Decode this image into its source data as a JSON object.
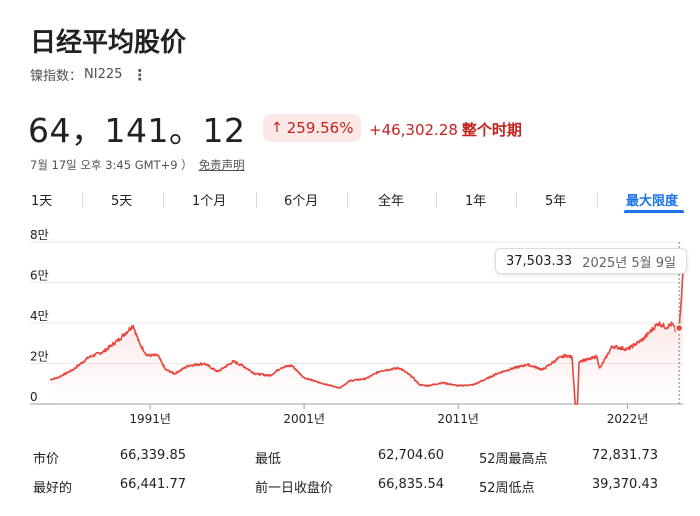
{
  "header": {
    "title": "日经平均股价",
    "index_label": "镍指数：",
    "ticker": "NI225",
    "more_icon": "more-vert-icon"
  },
  "quote": {
    "price": "64，141。12",
    "change_percent": "259.56%",
    "change_arrow": "↑",
    "change_abs": "+46,302.28",
    "period_label": "整个时期",
    "timestamp": "7월 17일 오후 3:45 GMT+9 ）",
    "disclaimer": "免责声明",
    "trend_color": "#c5221f"
  },
  "tabs": [
    {
      "label": "1天",
      "active": false
    },
    {
      "label": "5天",
      "active": false
    },
    {
      "label": "1个月",
      "active": false
    },
    {
      "label": "6个月",
      "active": false
    },
    {
      "label": "全年",
      "active": false
    },
    {
      "label": "1年",
      "active": false
    },
    {
      "label": "5年",
      "active": false
    },
    {
      "label": "最大限度",
      "active": true
    }
  ],
  "tooltip": {
    "value": "37,503.33",
    "date": "2025년 5월 9일"
  },
  "chart_data": {
    "type": "line",
    "y_tick_labels": [
      "8만",
      "6만",
      "4만",
      "2만",
      "0"
    ],
    "y_ticks": [
      80000,
      60000,
      40000,
      20000,
      0
    ],
    "ylim": [
      0,
      80000
    ],
    "x_tick_labels": [
      "1991년",
      "2001년",
      "2011년",
      "2022년"
    ],
    "x_ticks": [
      1991,
      2001,
      2011,
      2022
    ],
    "xlim": [
      1984.5,
      2025.6
    ],
    "line_color": "#e8453c",
    "series": [
      {
        "x": [
          1984.5,
          1985,
          1986,
          1987,
          1988,
          1989,
          1989.9,
          1990.3,
          1990.8,
          1991.5,
          1992,
          1992.6,
          1993.5,
          1994.5,
          1995.4,
          1996.4,
          1997,
          1997.8,
          1998.8,
          1999.5,
          2000.2,
          2001,
          2002,
          2003.3,
          2004,
          2005,
          2006,
          2007.2,
          2008,
          2008.5,
          2009,
          2010,
          2011,
          2012,
          2013,
          2013.5,
          2014.5,
          2015.5,
          2016.5,
          2017.5,
          2018,
          2018.4,
          2018.6,
          2018.75,
          2018.85,
          2019,
          2019.5,
          2020,
          2020.2,
          2021,
          2022,
          2023,
          2024,
          2024.5,
          2024.9,
          2025.1,
          2025.35,
          2025.5,
          2025.6
        ],
        "y": [
          12000,
          13000,
          17000,
          23000,
          26000,
          32000,
          38900,
          30000,
          24000,
          24000,
          17000,
          15000,
          19000,
          20000,
          16000,
          21000,
          19000,
          15000,
          14000,
          18000,
          19000,
          13000,
          10500,
          8000,
          11500,
          12500,
          16500,
          17800,
          13500,
          9500,
          9000,
          10500,
          9000,
          9500,
          13000,
          15000,
          17500,
          19500,
          17000,
          22500,
          24000,
          23000,
          0,
          0,
          21000,
          21500,
          22000,
          23500,
          17500,
          28500,
          27000,
          32000,
          40000,
          38000,
          39500,
          36500,
          37503,
          52000,
          66339
        ]
      }
    ]
  },
  "stats": {
    "rows": [
      {
        "l1": "市价",
        "v1": "66,339.85",
        "l2": "最低",
        "v2": "62,704.60",
        "l3": "52周最高点",
        "v3": "72,831.73"
      },
      {
        "l1": "最好的",
        "v1": "66,441.77",
        "l2": "前一日收盘价",
        "v2": "66,835.54",
        "l3": "52周低点",
        "v3": "39,370.43"
      }
    ]
  }
}
